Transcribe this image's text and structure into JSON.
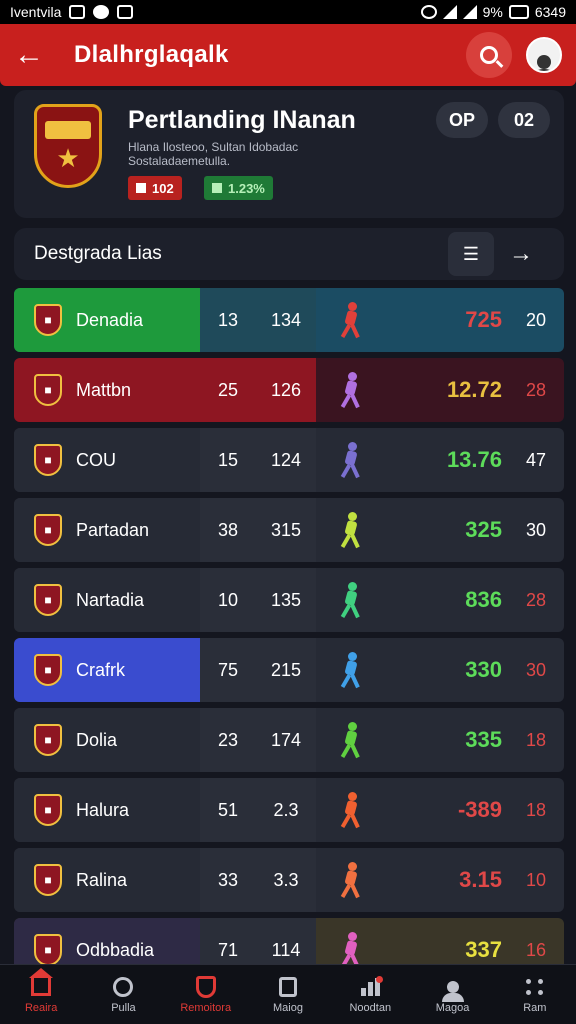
{
  "status_bar": {
    "carrier": "Iventvila",
    "time": "6349",
    "battery": "9%"
  },
  "app_bar": {
    "title": "Dlalhrglaqalk"
  },
  "match": {
    "title": "Pertlanding INanan",
    "line1": "Hlana Ilosteoo, Sultan Idobadac",
    "line2": "Sostaladaemetulla.",
    "chip_red": "102",
    "chip_green": "1.23%",
    "pill_left": "OP",
    "pill_right": "02"
  },
  "section": {
    "label": "Destgrada Lias"
  },
  "rows": [
    {
      "team": "Denadia",
      "s1": "13",
      "s2": "134",
      "score": "725",
      "last": "20",
      "bg": "#1e9a3c",
      "stats_bg": "#1f4a5a",
      "score_bg": "#1b4c63",
      "score_color": "#e04848",
      "last_color": "#ffffff",
      "player": "#e0403a"
    },
    {
      "team": "Mattbn",
      "s1": "25",
      "s2": "126",
      "score": "12.72",
      "last": "28",
      "bg": "#8e1622",
      "stats_bg": "#8e1622",
      "score_bg": "#3a1420",
      "score_color": "#e8c040",
      "last_color": "#e04848",
      "player": "#b070e0"
    },
    {
      "team": "COU",
      "s1": "15",
      "s2": "124",
      "score": "13.76",
      "last": "47",
      "bg": "#262a35",
      "stats_bg": "#2a2e39",
      "score_bg": "#262a35",
      "score_color": "#5ddc5a",
      "last_color": "#ffffff",
      "player": "#7a70d0"
    },
    {
      "team": "Partadan",
      "s1": "38",
      "s2": "315",
      "score": "325",
      "last": "30",
      "bg": "#262a35",
      "stats_bg": "#2a2e39",
      "score_bg": "#262a35",
      "score_color": "#5ddc5a",
      "last_color": "#ffffff",
      "player": "#c0e040"
    },
    {
      "team": "Nartadia",
      "s1": "10",
      "s2": "135",
      "score": "836",
      "last": "28",
      "bg": "#262a35",
      "stats_bg": "#2a2e39",
      "score_bg": "#262a35",
      "score_color": "#5ddc5a",
      "last_color": "#e04848",
      "player": "#40d080"
    },
    {
      "team": "Crafrk",
      "s1": "75",
      "s2": "215",
      "score": "330",
      "last": "30",
      "bg": "#3a4ccf",
      "stats_bg": "#2a2e39",
      "score_bg": "#262a35",
      "score_color": "#5ddc5a",
      "last_color": "#e04848",
      "player": "#40a0e8"
    },
    {
      "team": "Dolia",
      "s1": "23",
      "s2": "174",
      "score": "335",
      "last": "18",
      "bg": "#262a35",
      "stats_bg": "#2a2e39",
      "score_bg": "#262a35",
      "score_color": "#5ddc5a",
      "last_color": "#e04848",
      "player": "#60d040"
    },
    {
      "team": "Halura",
      "s1": "51",
      "s2": "2.3",
      "score": "-389",
      "last": "18",
      "bg": "#262a35",
      "stats_bg": "#2a2e39",
      "score_bg": "#262a35",
      "score_color": "#e04848",
      "last_color": "#e04848",
      "player": "#f06030"
    },
    {
      "team": "Ralina",
      "s1": "33",
      "s2": "3.3",
      "score": "3.15",
      "last": "10",
      "bg": "#262a35",
      "stats_bg": "#2a2e39",
      "score_bg": "#262a35",
      "score_color": "#e04848",
      "last_color": "#e04848",
      "player": "#f07040"
    },
    {
      "team": "Odbbadia",
      "s1": "71",
      "s2": "114",
      "score": "337",
      "last": "16",
      "bg": "#2e2a45",
      "stats_bg": "#2a2e39",
      "score_bg": "#3a3628",
      "score_color": "#e8e040",
      "last_color": "#e04848",
      "player": "#e060c0"
    }
  ],
  "nav": [
    {
      "label": "Reaira",
      "icon": "home-icon"
    },
    {
      "label": "Pulla",
      "icon": "ball-icon"
    },
    {
      "label": "Remoitora",
      "icon": "shield-icon"
    },
    {
      "label": "Maiog",
      "icon": "box-icon"
    },
    {
      "label": "Noodtan",
      "icon": "chart-icon"
    },
    {
      "label": "Magoa",
      "icon": "person-icon"
    },
    {
      "label": "Ram",
      "icon": "grid-icon"
    }
  ]
}
